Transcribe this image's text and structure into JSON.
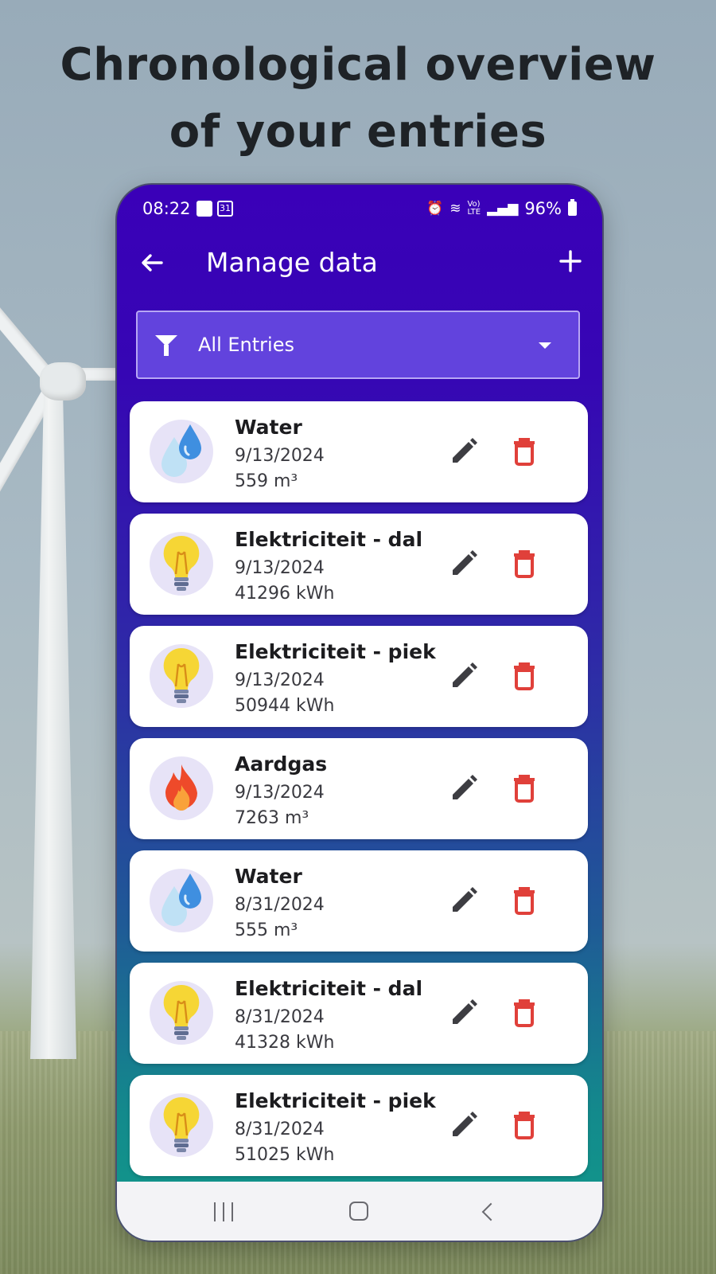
{
  "headline": {
    "line1": "Chronological overview",
    "line2": "of your entries"
  },
  "status_bar": {
    "time": "08:22",
    "calendar_day": "31",
    "battery": "96%"
  },
  "app_bar": {
    "title": "Manage data",
    "back_icon": "arrow-left-icon",
    "add_icon": "plus-icon"
  },
  "filter": {
    "icon": "filter-icon",
    "selected": "All Entries"
  },
  "entries": [
    {
      "icon": "water-drops-icon",
      "title": "Water",
      "date": "9/13/2024",
      "value": "559 m³"
    },
    {
      "icon": "lightbulb-icon",
      "title": "Elektriciteit - dal",
      "date": "9/13/2024",
      "value": "41296 kWh"
    },
    {
      "icon": "lightbulb-icon",
      "title": "Elektriciteit - piek",
      "date": "9/13/2024",
      "value": "50944 kWh"
    },
    {
      "icon": "flame-icon",
      "title": "Aardgas",
      "date": "9/13/2024",
      "value": "7263 m³"
    },
    {
      "icon": "water-drops-icon",
      "title": "Water",
      "date": "8/31/2024",
      "value": "555 m³"
    },
    {
      "icon": "lightbulb-icon",
      "title": "Elektriciteit - dal",
      "date": "8/31/2024",
      "value": "41328 kWh"
    },
    {
      "icon": "lightbulb-icon",
      "title": "Elektriciteit - piek",
      "date": "8/31/2024",
      "value": "51025 kWh"
    }
  ],
  "colors": {
    "app_bar": "#3a00b8",
    "filter_bg": "#6243dd",
    "delete": "#e0403a",
    "edit": "#3d3d42",
    "avatar_bg": "#e7e3f7"
  }
}
